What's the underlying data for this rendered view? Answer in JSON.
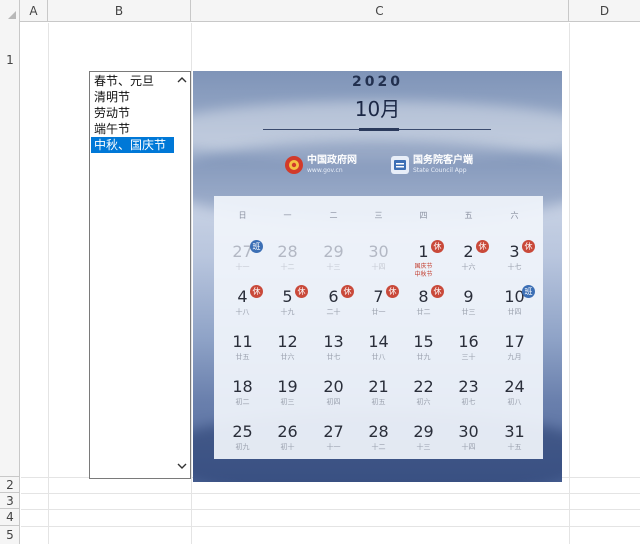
{
  "spreadsheet": {
    "columns": [
      "A",
      "B",
      "C",
      "D"
    ],
    "rows": [
      "1",
      "2",
      "3",
      "4",
      "5"
    ]
  },
  "listbox": {
    "items": [
      "春节、元旦",
      "清明节",
      "劳动节",
      "端午节",
      "中秋、国庆节"
    ],
    "selected_index": 4,
    "scroll_up_icon": "chevron-up-icon",
    "scroll_down_icon": "chevron-down-icon"
  },
  "calendar": {
    "year": "2020",
    "month": "10月",
    "brands": [
      {
        "name": "中国政府网",
        "sub": "www.gov.cn",
        "icon": "national-emblem-icon"
      },
      {
        "name": "国务院客户端",
        "sub": "State Council App",
        "icon": "app-icon"
      }
    ],
    "weekdays": [
      "日",
      "一",
      "二",
      "三",
      "四",
      "五",
      "六"
    ],
    "weeks": [
      [
        {
          "day": "27",
          "lunar": "十一",
          "muted": true,
          "badge": "班"
        },
        {
          "day": "28",
          "lunar": "十二",
          "muted": true
        },
        {
          "day": "29",
          "lunar": "十三",
          "muted": true
        },
        {
          "day": "30",
          "lunar": "十四",
          "muted": true
        },
        {
          "day": "1",
          "festival": [
            "国庆节",
            "中秋节"
          ],
          "badge": "休"
        },
        {
          "day": "2",
          "lunar": "十六",
          "badge": "休"
        },
        {
          "day": "3",
          "lunar": "十七",
          "badge": "休"
        }
      ],
      [
        {
          "day": "4",
          "lunar": "十八",
          "badge": "休"
        },
        {
          "day": "5",
          "lunar": "十九",
          "badge": "休"
        },
        {
          "day": "6",
          "lunar": "二十",
          "badge": "休"
        },
        {
          "day": "7",
          "lunar": "廿一",
          "badge": "休"
        },
        {
          "day": "8",
          "lunar": "廿二",
          "badge": "休"
        },
        {
          "day": "9",
          "lunar": "廿三"
        },
        {
          "day": "10",
          "lunar": "廿四",
          "badge": "班"
        }
      ],
      [
        {
          "day": "11",
          "lunar": "廿五"
        },
        {
          "day": "12",
          "lunar": "廿六"
        },
        {
          "day": "13",
          "lunar": "廿七"
        },
        {
          "day": "14",
          "lunar": "廿八"
        },
        {
          "day": "15",
          "lunar": "廿九"
        },
        {
          "day": "16",
          "lunar": "三十"
        },
        {
          "day": "17",
          "lunar": "九月"
        }
      ],
      [
        {
          "day": "18",
          "lunar": "初二"
        },
        {
          "day": "19",
          "lunar": "初三"
        },
        {
          "day": "20",
          "lunar": "初四"
        },
        {
          "day": "21",
          "lunar": "初五"
        },
        {
          "day": "22",
          "lunar": "初六"
        },
        {
          "day": "23",
          "lunar": "初七"
        },
        {
          "day": "24",
          "lunar": "初八"
        }
      ],
      [
        {
          "day": "25",
          "lunar": "初九"
        },
        {
          "day": "26",
          "lunar": "初十"
        },
        {
          "day": "27",
          "lunar": "十一"
        },
        {
          "day": "28",
          "lunar": "十二"
        },
        {
          "day": "29",
          "lunar": "十三"
        },
        {
          "day": "30",
          "lunar": "十四"
        },
        {
          "day": "31",
          "lunar": "十五"
        }
      ]
    ],
    "colors": {
      "rest_badge": "#c9493a",
      "work_badge": "#3c6fb5",
      "festival": "#c23b2c"
    }
  }
}
